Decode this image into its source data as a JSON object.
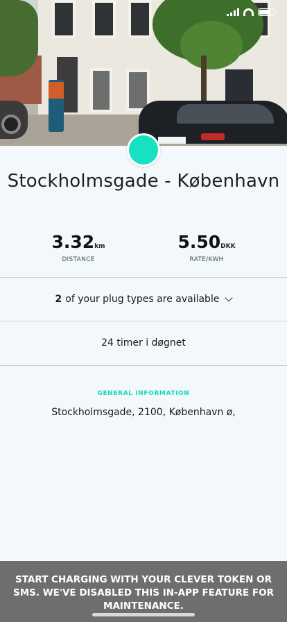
{
  "status_bar": {
    "time": ""
  },
  "station": {
    "name": "Stockholmsgade - København",
    "distance_value": "3.32",
    "distance_unit": "km",
    "distance_label": "DISTANCE",
    "rate_value": "5.50",
    "rate_unit": "DKK",
    "rate_label": "RATE/KWH"
  },
  "plugs": {
    "count": "2",
    "text": "of your plug types are available"
  },
  "hours": "24 timer i døgnet",
  "general_information": {
    "heading": "GENERAL INFORMATION",
    "address": "Stockholmsgade, 2100, København ø,"
  },
  "banner": {
    "line1": "START CHARGING WITH YOUR CLEVER TOKEN OR",
    "line2": "SMS. WE'VE DISABLED THIS IN-APP FEATURE FOR",
    "line3": "MAINTENANCE."
  },
  "colors": {
    "accent": "#18e0c2",
    "banner": "#6e6e6e",
    "background": "#f2f8fc"
  }
}
